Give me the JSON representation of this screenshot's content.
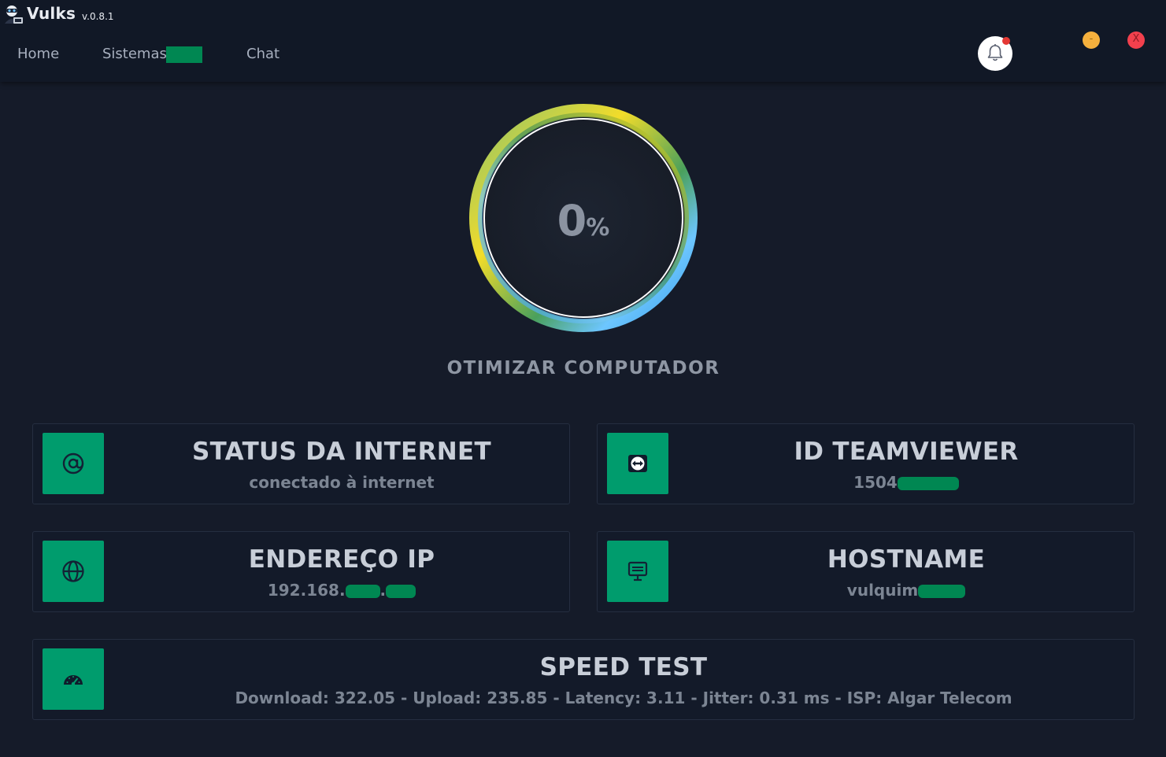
{
  "app": {
    "name": "Vulks",
    "version": "v.0.8.1",
    "logo_icon": "hacker-mascot-icon"
  },
  "nav": {
    "items": [
      {
        "label": "Home"
      },
      {
        "label": "Sistemas"
      },
      {
        "label": "Chat"
      }
    ]
  },
  "header": {
    "bell_icon": "bell-icon",
    "has_notification": true,
    "minimize_label": "-",
    "close_label": "X"
  },
  "gauge": {
    "value": "0",
    "unit": "%",
    "progress": 0,
    "label": "OTIMIZAR COMPUTADOR"
  },
  "cards": {
    "internet": {
      "title": "STATUS DA INTERNET",
      "value": "conectado à internet",
      "icon": "at-sign-icon"
    },
    "teamviewer": {
      "title": "ID TEAMVIEWER",
      "value": "1504",
      "icon": "teamviewer-icon"
    },
    "ip": {
      "title": "ENDEREÇO IP",
      "value": "192.168.",
      "icon": "globe-icon"
    },
    "hostname": {
      "title": "HOSTNAME",
      "value": "vulquim",
      "icon": "monitor-icon"
    },
    "speed": {
      "title": "SPEED TEST",
      "value": "Download: 322.05 - Upload: 235.85 - Latency: 3.11 - Jitter: 0.31 ms - ISP: Algar Telecom",
      "icon": "speedometer-icon"
    }
  },
  "colors": {
    "background": "#151b29",
    "accent": "#009c6d",
    "redaction": "#008752"
  }
}
